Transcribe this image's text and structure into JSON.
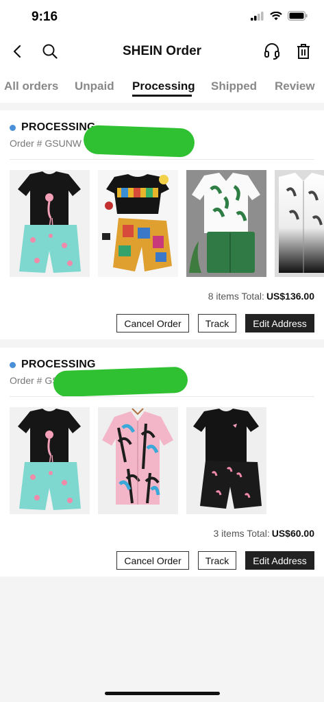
{
  "status_bar": {
    "time": "9:16"
  },
  "header": {
    "title": "SHEIN Order"
  },
  "tabs": [
    {
      "label": "All orders"
    },
    {
      "label": "Unpaid"
    },
    {
      "label": "Processing"
    },
    {
      "label": "Shipped"
    },
    {
      "label": "Review"
    }
  ],
  "active_tab": "Processing",
  "orders": [
    {
      "status": "PROCESSING",
      "order_prefix": "Order #",
      "order_number_visible": "GSUNW",
      "items": [
        {
          "icon": "flamingo-tee-shorts-set"
        },
        {
          "icon": "colorblock-tee-shorts-set"
        },
        {
          "icon": "tropical-leaf-shirt-shorts-set"
        },
        {
          "icon": "ombre-leaf-shirt"
        }
      ],
      "total_label": "8 items Total:",
      "total_amount": "US$136.00",
      "buttons": {
        "cancel": "Cancel Order",
        "track": "Track",
        "edit": "Edit Address"
      }
    },
    {
      "status": "PROCESSING",
      "order_prefix": "Order #",
      "order_number_visible": "GS",
      "items": [
        {
          "icon": "flamingo-tee-shorts-set"
        },
        {
          "icon": "palm-print-shirt"
        },
        {
          "icon": "black-tee-flamingo-shorts-set"
        }
      ],
      "total_label": "3 items Total:",
      "total_amount": "US$60.00",
      "buttons": {
        "cancel": "Cancel Order",
        "track": "Track",
        "edit": "Edit Address"
      }
    }
  ],
  "colors": {
    "status_dot": "#4a90d9",
    "redaction": "#2fc132",
    "button_dark": "#222222"
  }
}
